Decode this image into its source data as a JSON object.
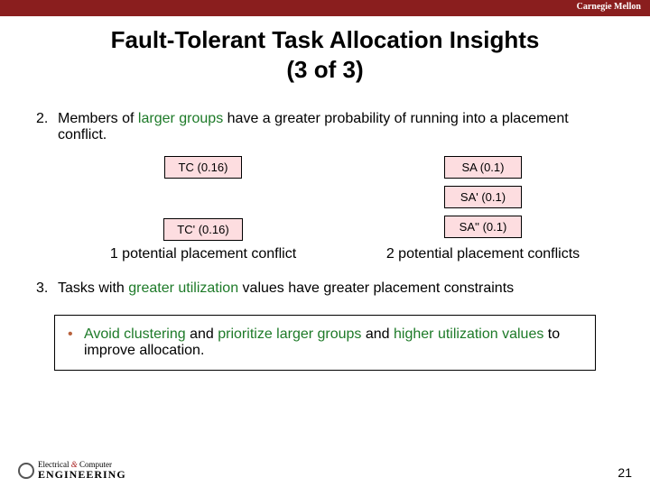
{
  "brand": "Carnegie Mellon",
  "title_line1": "Fault-Tolerant Task Allocation Insights",
  "title_line2": "(3 of 3)",
  "point2": {
    "num": "2.",
    "pre": "Members of ",
    "highlight": "larger groups",
    "post": " have a greater probability of running into a placement conflict."
  },
  "left_boxes": [
    "TC (0.16)",
    "TC' (0.16)"
  ],
  "right_boxes": [
    "SA (0.1)",
    "SA' (0.1)",
    "SA'' (0.1)"
  ],
  "caption_left": "1 potential placement conflict",
  "caption_right": "2 potential placement conflicts",
  "point3": {
    "num": "3.",
    "pre": "Tasks with ",
    "highlight": "greater utilization",
    "post": " values have greater placement constraints"
  },
  "bullet": {
    "a": "Avoid clustering",
    "b": " and ",
    "c": "prioritize larger groups",
    "d": " and ",
    "e": "higher utilization values",
    "f": " to improve allocation."
  },
  "footer_logo": {
    "line1": "Electrical",
    "amp": "&",
    "line1b": "Computer",
    "line2": "ENGINEERING"
  },
  "page_number": "21"
}
